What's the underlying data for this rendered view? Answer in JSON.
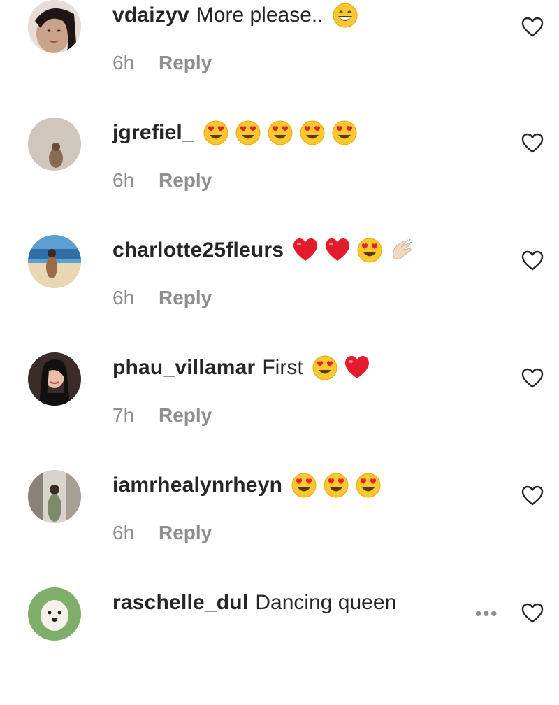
{
  "comments": [
    {
      "username": "vdaizyv",
      "text": "More please..",
      "emojis": [
        "grinning-face"
      ],
      "time": "6h",
      "reply": "Reply",
      "avatar": "avatar-woman-portrait",
      "avatar_color": "#c9a48a"
    },
    {
      "username": "jgrefiel_",
      "text": "",
      "emojis": [
        "heart-eyes",
        "heart-eyes",
        "heart-eyes",
        "heart-eyes",
        "heart-eyes"
      ],
      "time": "6h",
      "reply": "Reply",
      "avatar": "avatar-woman-light",
      "avatar_color": "#cfc6bd"
    },
    {
      "username": "charlotte25fleurs",
      "text": "",
      "emojis": [
        "red-heart",
        "red-heart",
        "heart-eyes",
        "clapping-hands"
      ],
      "time": "6h",
      "reply": "Reply",
      "avatar": "avatar-beach",
      "avatar_color": "#5c9fd0"
    },
    {
      "username": "phau_villamar",
      "text": "First",
      "emojis": [
        "heart-eyes",
        "red-heart"
      ],
      "time": "7h",
      "reply": "Reply",
      "avatar": "avatar-woman-dark",
      "avatar_color": "#3b2c2a"
    },
    {
      "username": "iamrhealynrheyn",
      "text": "",
      "emojis": [
        "heart-eyes",
        "heart-eyes",
        "heart-eyes"
      ],
      "time": "6h",
      "reply": "Reply",
      "avatar": "avatar-woman-standing",
      "avatar_color": "#b7b1a8"
    },
    {
      "username": "raschelle_dul",
      "text": "Dancing queen",
      "emojis": [],
      "time": "",
      "reply": "",
      "avatar": "avatar-white-dog",
      "avatar_color": "#7fae6a",
      "more": "•••"
    }
  ],
  "colors": {
    "text": "#262626",
    "secondary": "#8e8e8e",
    "background": "#ffffff"
  }
}
